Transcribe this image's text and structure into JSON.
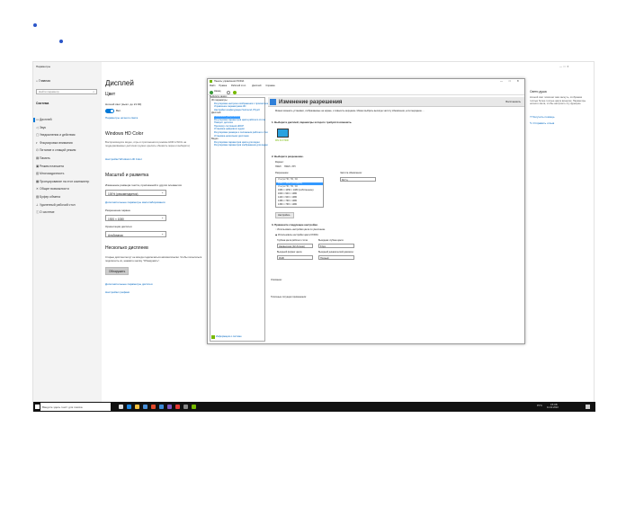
{
  "settings_window": {
    "title": "Параметры",
    "home": "Главная",
    "search_placeholder": "Найти параметр",
    "section": "Система",
    "nav": [
      {
        "label": "Дисплей",
        "icon": "display-icon"
      },
      {
        "label": "Звук",
        "icon": "sound-icon"
      },
      {
        "label": "Уведомления и действия",
        "icon": "notifications-icon"
      },
      {
        "label": "Фокусировка внимания",
        "icon": "focus-assist-icon"
      },
      {
        "label": "Питание и спящий режим",
        "icon": "power-icon"
      },
      {
        "label": "Память",
        "icon": "storage-icon"
      },
      {
        "label": "Режим планшета",
        "icon": "tablet-icon"
      },
      {
        "label": "Многозадачность",
        "icon": "multitasking-icon"
      },
      {
        "label": "Проецирование на этот компьютер",
        "icon": "projecting-icon"
      },
      {
        "label": "Общие возможности",
        "icon": "shared-experiences-icon"
      },
      {
        "label": "Буфер обмена",
        "icon": "clipboard-icon"
      },
      {
        "label": "Удаленный рабочий стол",
        "icon": "remote-desktop-icon"
      },
      {
        "label": "О системе",
        "icon": "about-icon"
      }
    ]
  },
  "display": {
    "title": "Дисплей",
    "color_section": "Цвет",
    "night_light_label": "Ночной свет (выкл. до 21:00)",
    "toggle_state": "Вкл.",
    "night_light_link": "Параметры ночного света",
    "hd_title": "Windows HD Color",
    "hd_text": "Воспроизводите видео, игры и приложения в режиме HDR в WCG на поддерживаемых дисплеях (нужно сделать обновить экран и выберите)",
    "hd_link": "Настройки Windows HD Color",
    "scale_title": "Масштаб и разметка",
    "scale_label": "Изменение размера текста, приложений и других элементов",
    "scale_value": "100% (рекомендуется)",
    "advanced_scale_link": "Дополнительные параметры масштабирования",
    "resolution_label": "Разрешение экрана",
    "resolution_value": "1920 × 1080",
    "orientation_label": "Ориентация дисплея",
    "orientation_value": "Альбомная",
    "multi_title": "Несколько дисплеев",
    "multi_text": "Старые дисплеи могут не всегда подключаться автоматически. Чтобы попытаться подключить их, нажмите кнопку \"Обнаружить\".",
    "detect_button": "Обнаружить",
    "advanced_display_link": "Дополнительные параметры дисплея",
    "graphics_link": "Настройки графики"
  },
  "nvidia": {
    "window_title": "Панель управления NVIDIA",
    "menu": [
      "Файл",
      "Правка",
      "Рабочий стол",
      "Дисплей",
      "Справка"
    ],
    "back_label": "Назад",
    "task_label": "Выберите задачу...",
    "tree": [
      "3D-параметры",
      "Регулировка настроек изображения с просмотром",
      "Управление параметрами 3D",
      "Настройки конфигурации Surround, PhysX",
      "Дисплей",
      "Изменение разрешения",
      "Регулировка параметров цвета рабочего стола",
      "Поворот дисплея",
      "Просмотр состояния HDCP",
      "Установка цифрового аудио",
      "Регулировка размера и положения рабочего стола",
      "Установка нескольких дисплеев",
      "Видео",
      "Регулировка параметров цвета для видео",
      "Регулировка параметров изображения для видео"
    ],
    "heading": "Изменение разрешения",
    "restore_defaults": "Восстановить",
    "intro": "Можно изменить установки, отображаемые на экране, и повысить мерцание. Можно выбрать высокую частоту обновления, если мерцание ...",
    "step1": "1. Выберите дисплей, параметры которого требуется изменить.",
    "monitor_label": "MSI 3CX7000",
    "step2": "2. Выберите разрешение.",
    "type_label": "Формат:",
    "type_values": [
      "HDMI",
      "HDMI - PPI"
    ],
    "resolution_label": "Разрешение:",
    "refresh_label": "Частота обновления:",
    "refresh_value": "60 Гц",
    "resolutions": [
      "Ультра HD, HD, SD",
      "1920 × 1080 (исходное)",
      "Ультра HD, HD, SD",
      "1680 × 1050 × 1080 (собственное)",
      "1600 × 900 × 1080",
      "1440 × 900 × 1080",
      "1366 × 768 × 1080",
      "1360 × 768 × 1080"
    ],
    "customize_button": "Настройка...",
    "step3": "3. Примените следующие настройки.",
    "opt1": "Использовать настройки цвета по умолчанию",
    "opt2": "Использовать настройки цвета NVIDIA",
    "depth_label": "Глубина цвета рабочего стола:",
    "depth_value": "Наивысшая (32-битная)",
    "out_depth_label": "Выходная глубина цвета:",
    "out_depth_value": "8 bpc",
    "format_label": "Выходной формат цвета:",
    "format_value": "RGB",
    "dynamic_label": "Выходной динамический диапазон:",
    "dynamic_value": "Полный",
    "desc_label": "Описание:",
    "typical_label": "Типичные ситуации применения:",
    "sysinfo": "Информация о системе"
  },
  "right_panel": {
    "title": "Свети душа",
    "text": "Ночной свет помогает вам заснуть, отображая теплые более теплые цвета вечером. Параметры ночного света, чтобы настроить эту функцию.",
    "help_link": "Получить помощь",
    "feedback_link": "Отправить отзыв"
  },
  "taskbar": {
    "search_text": "Введите здесь текст для поиска",
    "tray_lang": "РУС",
    "time": "15:08",
    "date": "11.02.2022"
  }
}
